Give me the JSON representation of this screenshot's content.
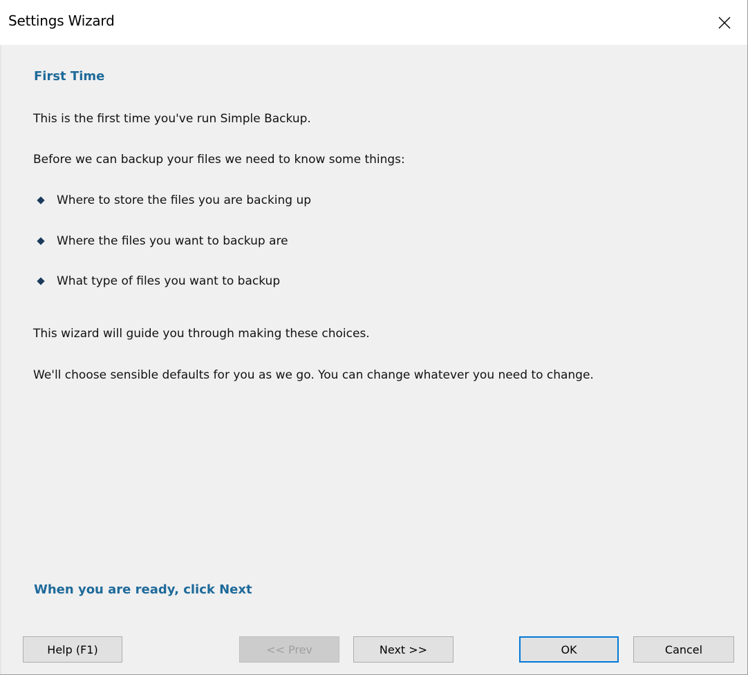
{
  "window": {
    "title": "Settings Wizard"
  },
  "content": {
    "heading": "First Time",
    "intro": "This is the first time you've run Simple Backup.",
    "lead": "Before we can backup your files we need to know some things:",
    "bullets": [
      "Where to store the files you are backing up",
      "Where the files you want to backup are",
      "What type of files you want to backup"
    ],
    "guide": "This wizard will guide you through making these choices.",
    "defaults": "We'll choose sensible defaults for you as we go. You can change whatever you need to change.",
    "footer_note": "When you are ready, click Next"
  },
  "buttons": {
    "help": "Help (F1)",
    "prev": "<< Prev",
    "next": "Next >>",
    "ok": "OK",
    "cancel": "Cancel"
  },
  "colors": {
    "accent": "#1e6a9a",
    "background": "#f0f0f0",
    "focus": "#0078d7"
  }
}
